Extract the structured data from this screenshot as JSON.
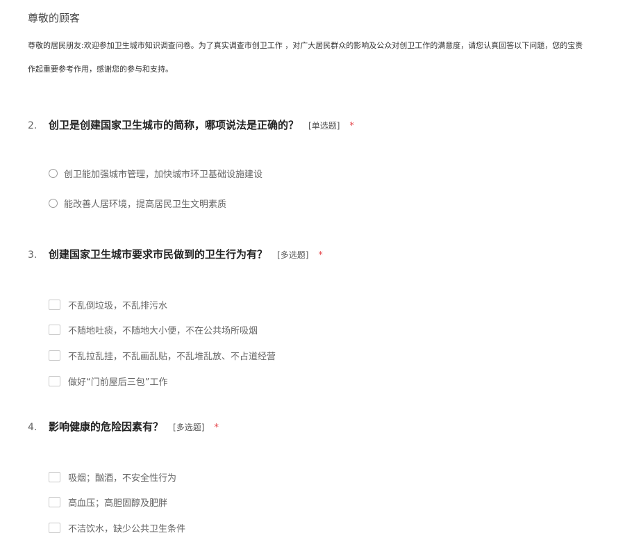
{
  "survey": {
    "greeting": "尊敬的顾客",
    "intro_line1": "尊敬的居民朋友:欢迎参加卫生城市知识调查问卷。为了真实调查市创卫工作 ，对广大居民群众的影响及公众对创卫工作的满意度，请您认真回答以下问题，您的宝贵",
    "intro_line2": "作起重要参考作用，感谢您的参与和支持。"
  },
  "questions": [
    {
      "number": "2.",
      "title": "创卫是创建国家卫生城市的简称，哪项说法是正确的？",
      "type": "[单选题]",
      "required_mark": "*",
      "options": [
        "创卫能加强城市管理，加快城市环卫基础设施建设",
        "能改善人居环境，提高居民卫生文明素质"
      ]
    },
    {
      "number": "3.",
      "title": "创建国家卫生城市要求市民做到的卫生行为有？",
      "type": "[多选题]",
      "required_mark": "*",
      "options": [
        "不乱倒垃圾，不乱排污水",
        "不随地吐痰，不随地大小便，不在公共场所吸烟",
        "不乱拉乱挂，不乱画乱贴，不乱堆乱放、不占道经营",
        "做好“门前屋后三包”工作"
      ]
    },
    {
      "number": "4.",
      "title": "影响健康的危险因素有？",
      "type": "[多选题]",
      "required_mark": "*",
      "options": [
        "吸烟；酗酒，不安全性行为",
        "高血压；高胆固醇及肥胖",
        "不洁饮水，缺少公共卫生条件"
      ]
    }
  ]
}
